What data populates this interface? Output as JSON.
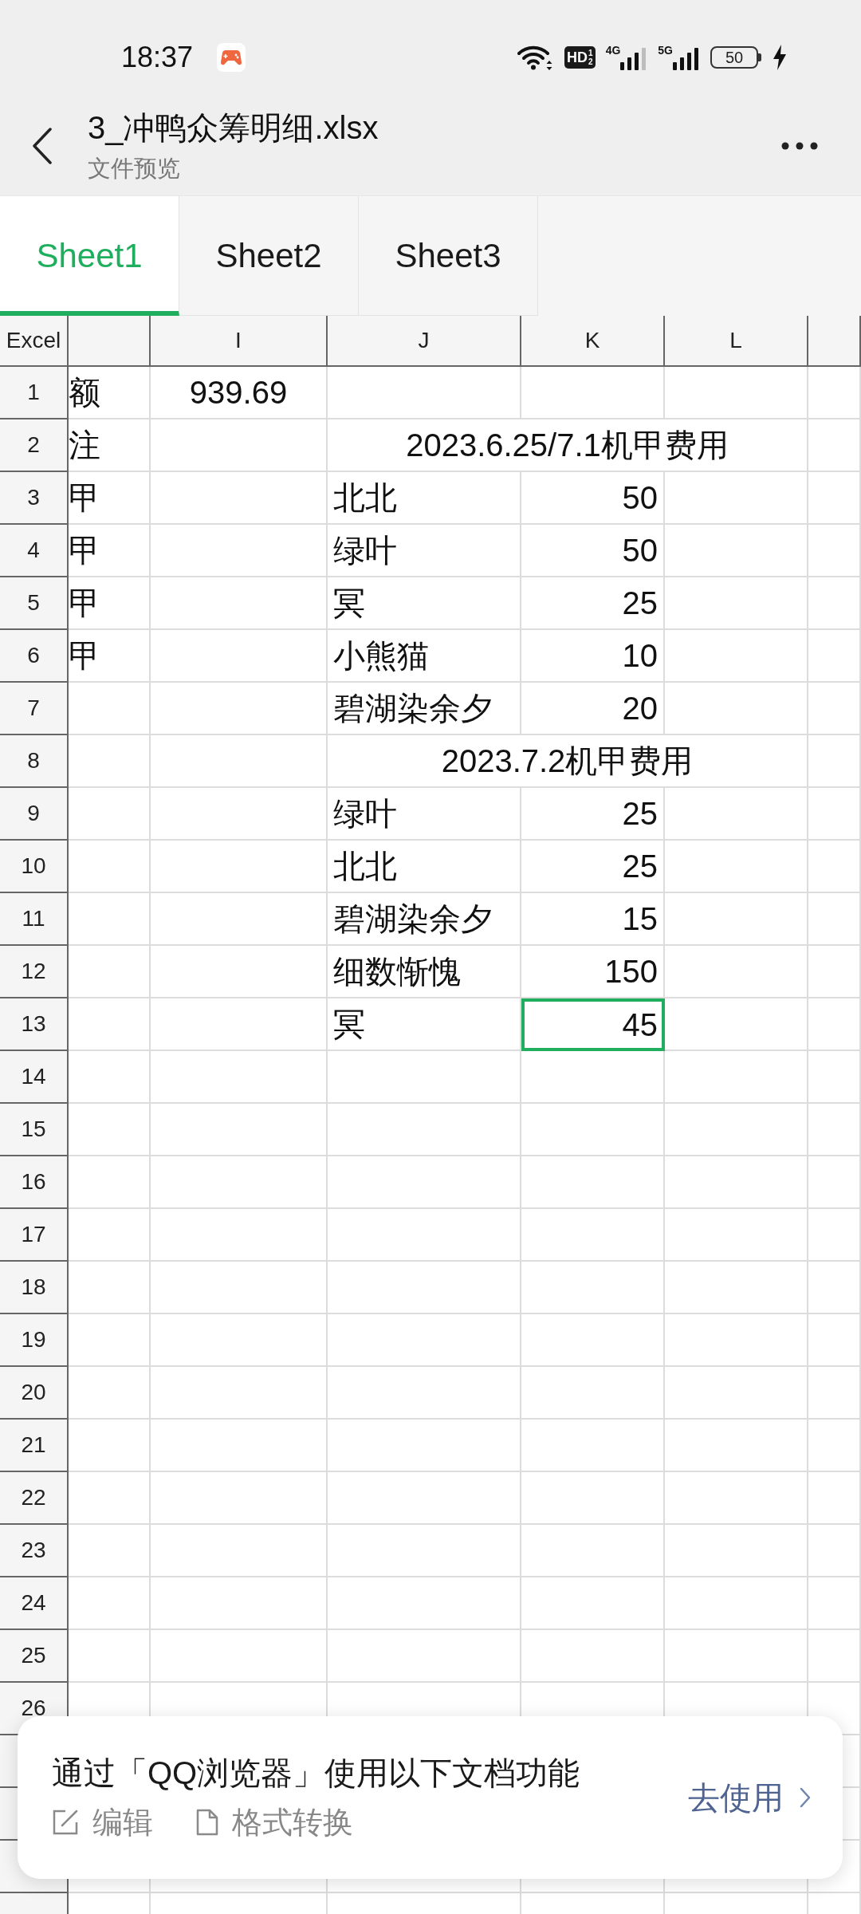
{
  "status_bar": {
    "time": "18:37",
    "hd": {
      "label": "HD",
      "sims": "12"
    },
    "networks": [
      {
        "label": "4G"
      },
      {
        "label": "5G"
      }
    ],
    "battery": "50"
  },
  "header": {
    "title": "3_冲鸭众筹明细.xlsx",
    "subtitle": "文件预览"
  },
  "tabs": [
    {
      "label": "Sheet1",
      "selected": true
    },
    {
      "label": "Sheet2",
      "selected": false
    },
    {
      "label": "Sheet3",
      "selected": false
    }
  ],
  "sheet": {
    "corner": "Excel",
    "columns": [
      "I",
      "J",
      "K",
      "L"
    ],
    "rows": [
      {
        "number": "1",
        "h": "额",
        "i": "939.69"
      },
      {
        "number": "2",
        "h": "注",
        "section_heading": "2023.6.25/7.1机甲费用"
      },
      {
        "number": "3",
        "h": "甲",
        "j": "北北",
        "k": {
          "text": "50",
          "selected": false
        }
      },
      {
        "number": "4",
        "h": "甲",
        "j": "绿叶",
        "k": {
          "text": "50",
          "selected": false
        }
      },
      {
        "number": "5",
        "h": "甲",
        "j": "冥",
        "k": {
          "text": "25",
          "selected": false
        }
      },
      {
        "number": "6",
        "h": "甲",
        "j": "小熊猫",
        "k": {
          "text": "10",
          "selected": false
        }
      },
      {
        "number": "7",
        "j": "碧湖染余夕",
        "k": {
          "text": "20",
          "selected": false
        }
      },
      {
        "number": "8",
        "section_heading": "2023.7.2机甲费用"
      },
      {
        "number": "9",
        "j": "绿叶",
        "k": {
          "text": "25",
          "selected": false
        }
      },
      {
        "number": "10",
        "j": "北北",
        "k": {
          "text": "25",
          "selected": false
        }
      },
      {
        "number": "11",
        "j": "碧湖染余夕",
        "k": {
          "text": "15",
          "selected": false
        }
      },
      {
        "number": "12",
        "j": "细数惭愧",
        "k": {
          "text": "150",
          "selected": false
        }
      },
      {
        "number": "13",
        "j": "冥",
        "k": {
          "text": "45",
          "selected": true
        }
      },
      {
        "number": "14"
      },
      {
        "number": "15"
      },
      {
        "number": "16"
      },
      {
        "number": "17"
      },
      {
        "number": "18"
      },
      {
        "number": "19"
      },
      {
        "number": "20"
      },
      {
        "number": "21"
      },
      {
        "number": "22"
      },
      {
        "number": "23"
      },
      {
        "number": "24"
      },
      {
        "number": "25"
      },
      {
        "number": "26"
      }
    ]
  },
  "promo": {
    "message": "通过「QQ浏览器」使用以下文档功能",
    "features": [
      {
        "kind": "edit",
        "label": "编辑"
      },
      {
        "kind": "convert",
        "label": "格式转换"
      }
    ],
    "action": "去使用"
  }
}
